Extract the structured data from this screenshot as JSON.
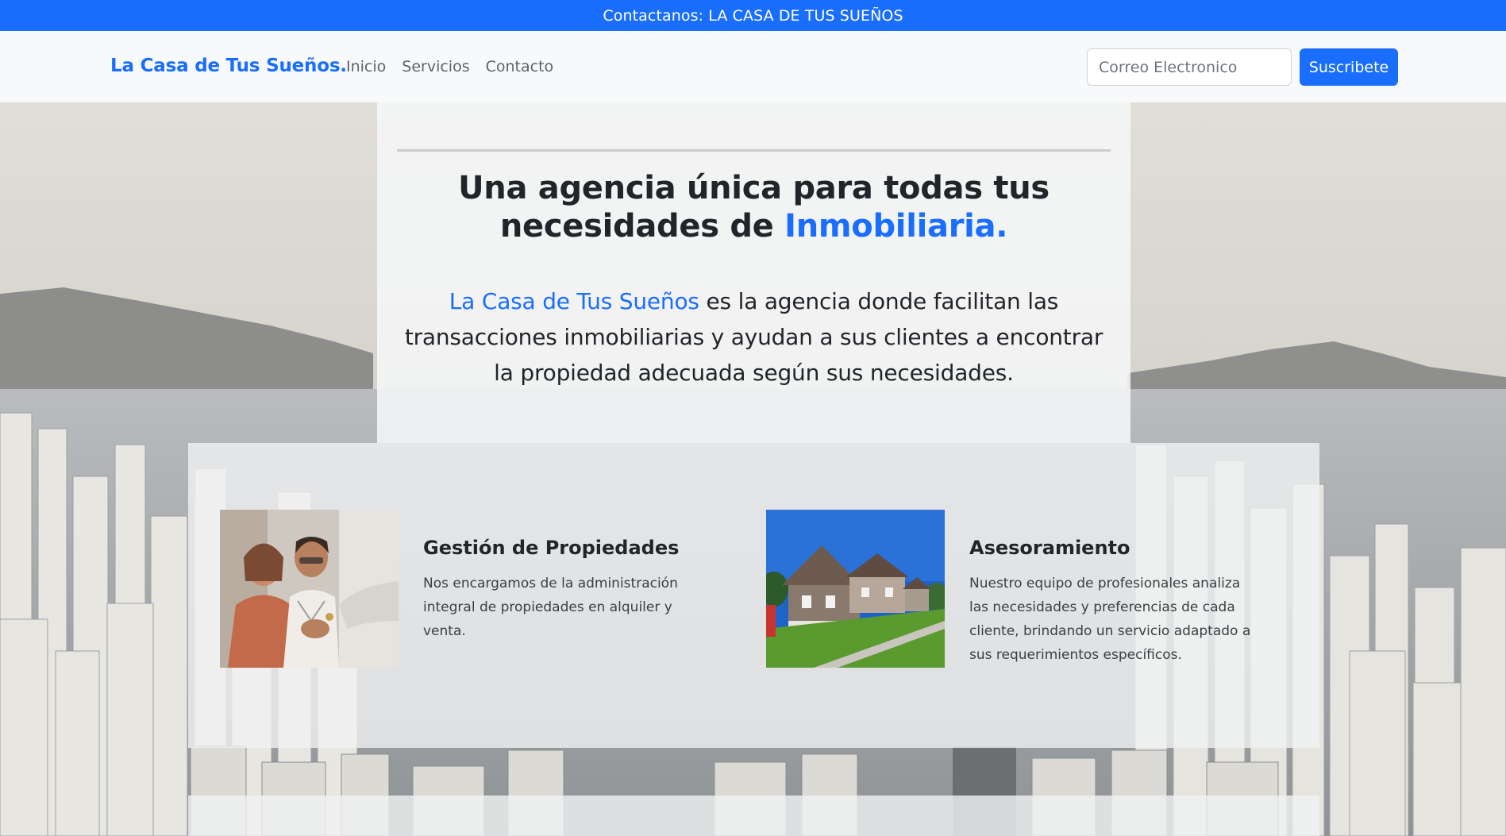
{
  "topbar": {
    "text": "Contactanos: LA CASA DE TUS SUEÑOS"
  },
  "nav": {
    "brand": "La Casa de Tus Sueños.",
    "links": [
      {
        "label": "Inicio"
      },
      {
        "label": "Servicios"
      },
      {
        "label": "Contacto"
      }
    ],
    "subscribe": {
      "placeholder": "Correo Electronico",
      "button_label": "Suscribete"
    }
  },
  "hero": {
    "title_part1": "Una agencia única para todas tus necesidades de",
    "title_accent": "Inmobiliaria.",
    "text_accent": "La Casa de Tus Sueños",
    "text_rest": "es la agencia donde facilitan las transacciones inmobiliarias y ayudan a sus clientes a encontrar la propiedad adecuada según sus necesidades."
  },
  "services": [
    {
      "title": "Gestión de Propiedades",
      "description": "Nos encargamos de la administración integral de propiedades en alquiler y venta.",
      "image_icon": "couple-receiving-keys-photo"
    },
    {
      "title": "Asesoramiento",
      "description": "Nuestro equipo de profesionales analiza las necesidades y preferencias de cada cliente, brindando un servicio adaptado a sus requerimientos específicos.",
      "image_icon": "suburban-houses-photo"
    }
  ],
  "colors": {
    "primary": "#1a6efd",
    "navbar_bg": "#f8f9fa",
    "text_dark": "#212529"
  }
}
